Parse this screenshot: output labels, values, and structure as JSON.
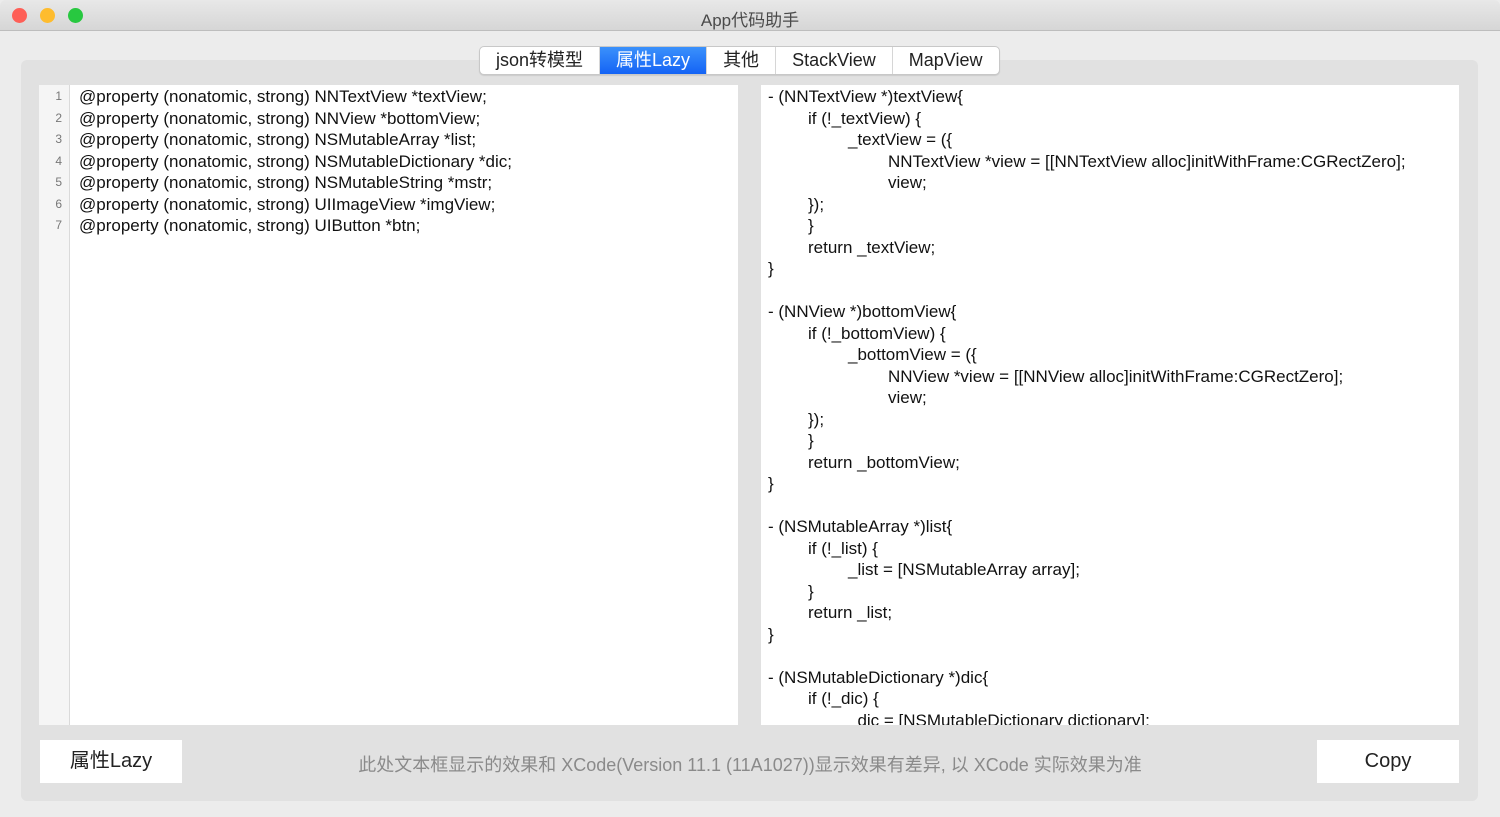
{
  "window": {
    "title": "App代码助手",
    "colors": {
      "close": "#fe5f57",
      "minimize": "#febc2e",
      "zoom": "#28c840",
      "accent": "#1a6ef6"
    }
  },
  "tabs": [
    {
      "label": "json转模型",
      "active": false
    },
    {
      "label": "属性Lazy",
      "active": true
    },
    {
      "label": "其他",
      "active": false
    },
    {
      "label": "StackView",
      "active": false
    },
    {
      "label": "MapView",
      "active": false
    }
  ],
  "input_lines": [
    "@property (nonatomic, strong) NNTextView *textView;",
    "@property (nonatomic, strong) NNView *bottomView;",
    "@property (nonatomic, strong) NSMutableArray *list;",
    "@property (nonatomic, strong) NSMutableDictionary *dic;",
    "@property (nonatomic, strong) NSMutableString *mstr;",
    "@property (nonatomic, strong) UIImageView *imgView;",
    "@property (nonatomic, strong) UIButton *btn;"
  ],
  "line_numbers": [
    "1",
    "2",
    "3",
    "4",
    "5",
    "6",
    "7"
  ],
  "output_lines": [
    {
      "indent": 0,
      "text": "- (NNTextView *)textView{"
    },
    {
      "indent": 1,
      "text": "if (!_textView) {"
    },
    {
      "indent": 2,
      "text": "_textView = ({"
    },
    {
      "indent": 3,
      "text": "NNTextView *view = [[NNTextView alloc]initWithFrame:CGRectZero];"
    },
    {
      "indent": 3,
      "text": "view;"
    },
    {
      "indent": 1,
      "text": "});"
    },
    {
      "indent": 1,
      "text": "}"
    },
    {
      "indent": 1,
      "text": "return _textView;"
    },
    {
      "indent": 0,
      "text": "}"
    },
    {
      "indent": 0,
      "text": ""
    },
    {
      "indent": 0,
      "text": "- (NNView *)bottomView{"
    },
    {
      "indent": 1,
      "text": "if (!_bottomView) {"
    },
    {
      "indent": 2,
      "text": "_bottomView = ({"
    },
    {
      "indent": 3,
      "text": "NNView *view = [[NNView alloc]initWithFrame:CGRectZero];"
    },
    {
      "indent": 3,
      "text": "view;"
    },
    {
      "indent": 1,
      "text": "});"
    },
    {
      "indent": 1,
      "text": "}"
    },
    {
      "indent": 1,
      "text": "return _bottomView;"
    },
    {
      "indent": 0,
      "text": "}"
    },
    {
      "indent": 0,
      "text": ""
    },
    {
      "indent": 0,
      "text": "- (NSMutableArray *)list{"
    },
    {
      "indent": 1,
      "text": "if (!_list) {"
    },
    {
      "indent": 2,
      "text": "_list = [NSMutableArray array];"
    },
    {
      "indent": 1,
      "text": "}"
    },
    {
      "indent": 1,
      "text": "return _list;"
    },
    {
      "indent": 0,
      "text": "}"
    },
    {
      "indent": 0,
      "text": ""
    },
    {
      "indent": 0,
      "text": "- (NSMutableDictionary *)dic{"
    },
    {
      "indent": 1,
      "text": "if (!_dic) {"
    },
    {
      "indent": 2,
      "text": "_dic = [NSMutableDictionary dictionary];"
    }
  ],
  "footer": {
    "generate_button": "属性Lazy",
    "note": "此处文本框显示的效果和 XCode(Version 11.1 (11A1027))显示效果有差异, 以 XCode 实际效果为准",
    "copy_button": "Copy"
  }
}
